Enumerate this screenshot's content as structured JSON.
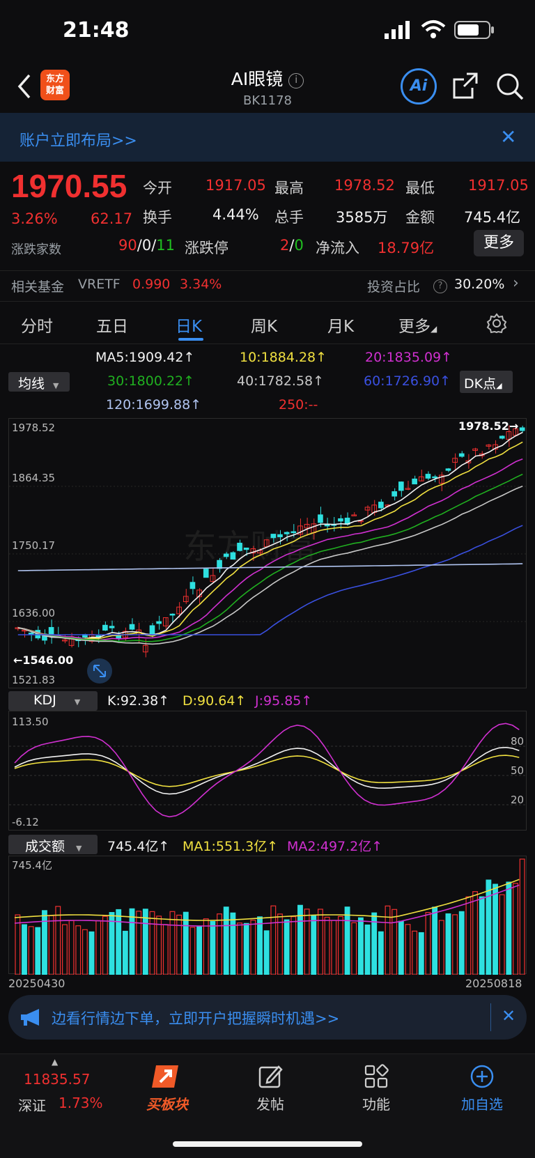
{
  "status_bar": {
    "time": "21:48"
  },
  "header": {
    "logo_line1": "东方",
    "logo_line2": "财富",
    "title": "AI眼镜",
    "code": "BK1178",
    "ai_label": "Ai"
  },
  "banner": {
    "text": "账户立即布局>>",
    "close": "✕"
  },
  "quote": {
    "price": "1970.55",
    "pct": "3.26%",
    "change": "62.17",
    "open_label": "今开",
    "open": "1917.05",
    "high_label": "最高",
    "high": "1978.52",
    "low_label": "最低",
    "low": "1917.05",
    "turnover_label": "换手",
    "turnover": "4.44%",
    "volume_label": "总手",
    "volume": "3585万",
    "amount_label": "金额",
    "amount": "745.4亿",
    "breadth_label": "涨跌家数",
    "up_count": "90",
    "slash1": "/",
    "flat_count": "0",
    "slash2": "/",
    "down_count": "11",
    "limit_label": "涨跌停",
    "limit_up": "2",
    "slash3": "/",
    "limit_down": "0",
    "netflow_label": "净流入",
    "netflow": "18.79亿",
    "more_button": "更多"
  },
  "fund_row": {
    "label": "相关基金",
    "name": "VRETF",
    "price": "0.990",
    "pct": "3.34%",
    "ratio_label": "投资占比",
    "ratio": "30.20%"
  },
  "tabs": [
    {
      "label": "分时"
    },
    {
      "label": "五日"
    },
    {
      "label": "日K"
    },
    {
      "label": "周K"
    },
    {
      "label": "月K"
    },
    {
      "label": "更多"
    }
  ],
  "ma_legend": {
    "selector": "均线",
    "ma5": "MA5:1909.42↑",
    "ma10": "10:1884.28↑",
    "ma20": "20:1835.09↑",
    "ma30": "30:1800.22↑",
    "ma40": "40:1782.58↑",
    "ma60": "60:1726.90↑",
    "ma120": "120:1699.88↑",
    "ma250": "250:--",
    "dk_button": "DK点",
    "colors": {
      "ma5": "#f2f2f2",
      "ma10": "#f0e040",
      "ma20": "#d030d0",
      "ma30": "#20b020",
      "ma40": "#c8c8c8",
      "ma60": "#3a50e0",
      "ma120": "#b0c4f0",
      "ma250": "#f03030"
    }
  },
  "main_chart": {
    "y_labels": [
      "1978.52",
      "1864.35",
      "1750.17",
      "1636.00",
      "1521.83"
    ],
    "max_marker": "1978.52→",
    "min_marker": "←1546.00",
    "watermark": "东方财富"
  },
  "kdj": {
    "selector": "KDJ",
    "k": "K:92.38↑",
    "d": "D:90.64↑",
    "j": "J:95.85↑",
    "y_labels": [
      "113.50",
      "80",
      "50",
      "20",
      "-6.12"
    ]
  },
  "volume": {
    "selector": "成交额",
    "value": "745.4亿↑",
    "ma1": "MA1:551.3亿↑",
    "ma2": "MA2:497.2亿↑",
    "y_label": "745.4亿",
    "start_date": "20250430",
    "end_date": "20250818"
  },
  "promo": {
    "text": "边看行情边下单，立即开户把握瞬时机遇>>",
    "close": "✕"
  },
  "bottom_nav": {
    "index_value": "11835.57",
    "index_name": "深证",
    "index_pct": "1.73%",
    "buy": "买板块",
    "post": "发帖",
    "functions": "功能",
    "add": "加自选"
  }
}
